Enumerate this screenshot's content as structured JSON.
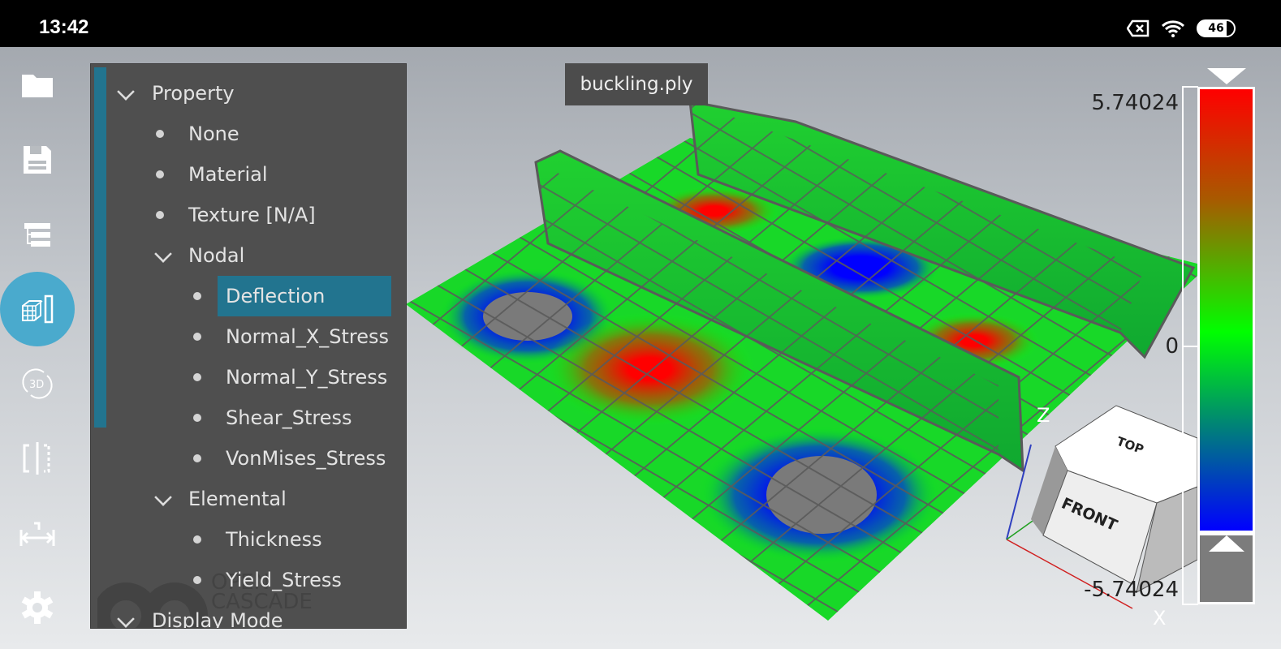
{
  "status_bar": {
    "time": "13:42",
    "battery": "46",
    "icons": [
      "sim-missing-icon",
      "wifi-icon",
      "battery-icon"
    ]
  },
  "toolbar": {
    "items": [
      {
        "name": "open-file-icon"
      },
      {
        "name": "save-icon"
      },
      {
        "name": "tree-icon"
      },
      {
        "name": "property-view-icon",
        "selected": true
      },
      {
        "name": "rotate-3d-icon"
      },
      {
        "name": "clipping-plane-icon"
      },
      {
        "name": "measure-icon"
      },
      {
        "name": "settings-icon"
      }
    ]
  },
  "panel": {
    "property": "Property",
    "none": "None",
    "material": "Material",
    "texture": "Texture [N/A]",
    "nodal": "Nodal",
    "nodal_items": [
      "Deflection",
      "Normal_X_Stress",
      "Normal_Y_Stress",
      "Shear_Stress",
      "VonMises_Stress"
    ],
    "selected": "Deflection",
    "elemental": "Elemental",
    "elemental_items": [
      "Thickness",
      "Yield_Stress"
    ],
    "display_mode": "Display Mode",
    "watermark": "OPEN CASCADE"
  },
  "viewer": {
    "filename": "buckling.ply",
    "axis_z": "Z",
    "axis_x": "X",
    "cube_top": "TOP",
    "cube_front": "FRONT"
  },
  "color_scale": {
    "max": "5.74024",
    "mid": "0",
    "min": "-5.74024",
    "colors": [
      "#ff0000",
      "#00ff00",
      "#0000ff"
    ]
  }
}
